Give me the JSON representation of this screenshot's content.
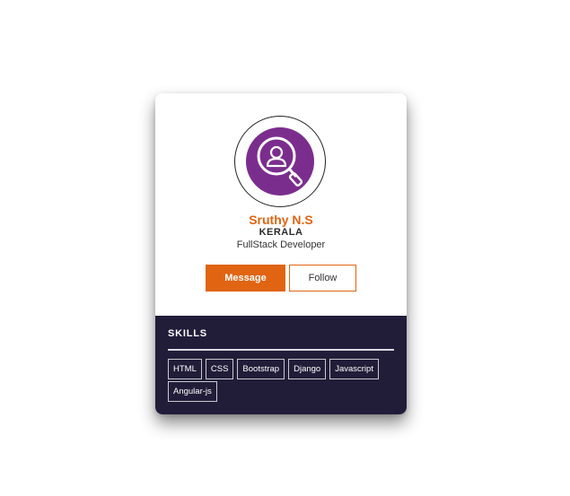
{
  "profile": {
    "name": "Sruthy N.S",
    "location": "KERALA",
    "role": "FullStack Developer",
    "avatar_icon": "user-search-icon"
  },
  "actions": {
    "message_label": "Message",
    "follow_label": "Follow"
  },
  "skills": {
    "title": "SKILLS",
    "items": [
      "HTML",
      "CSS",
      "Bootstrap",
      "Django",
      "Javascript",
      "Angular-js"
    ]
  },
  "colors": {
    "accent": "#e06412",
    "footer_bg": "#211d39",
    "avatar_bg": "#7b2d8e"
  }
}
